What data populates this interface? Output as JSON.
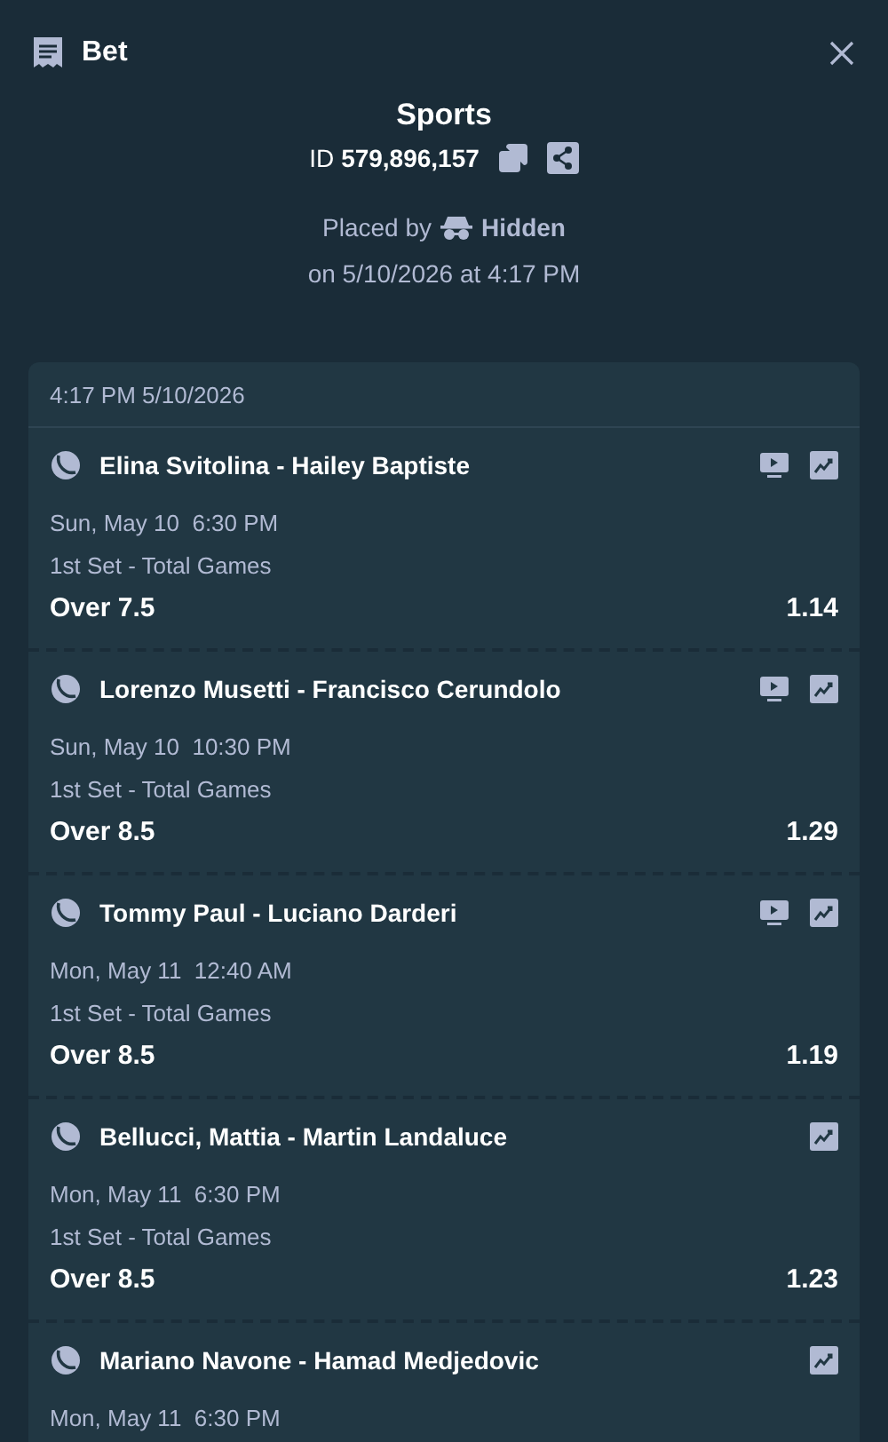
{
  "header": {
    "title": "Bet"
  },
  "summary": {
    "category": "Sports",
    "id_label": "ID",
    "id_value": "579,896,157",
    "placed_by_label": "Placed by",
    "placed_by_name": "Hidden",
    "placed_on": "on 5/10/2026 at 4:17 PM"
  },
  "slip": {
    "timestamp": "4:17 PM 5/10/2026",
    "legs": [
      {
        "match": "Elina Svitolina - Hailey Baptiste",
        "stream": true,
        "start": "Sun, May 10  6:30 PM",
        "market": "1st Set - Total Games",
        "selection": "Over 7.5",
        "odds": "1.14"
      },
      {
        "match": "Lorenzo Musetti - Francisco Cerundolo",
        "stream": true,
        "start": "Sun, May 10  10:30 PM",
        "market": "1st Set - Total Games",
        "selection": "Over 8.5",
        "odds": "1.29"
      },
      {
        "match": "Tommy Paul - Luciano Darderi",
        "stream": true,
        "start": "Mon, May 11  12:40 AM",
        "market": "1st Set - Total Games",
        "selection": "Over 8.5",
        "odds": "1.19"
      },
      {
        "match": "Bellucci, Mattia - Martin Landaluce",
        "stream": false,
        "start": "Mon, May 11  6:30 PM",
        "market": "1st Set - Total Games",
        "selection": "Over 8.5",
        "odds": "1.23"
      },
      {
        "match": "Mariano Navone - Hamad Medjedovic",
        "stream": false,
        "start": "Mon, May 11  6:30 PM"
      }
    ]
  }
}
